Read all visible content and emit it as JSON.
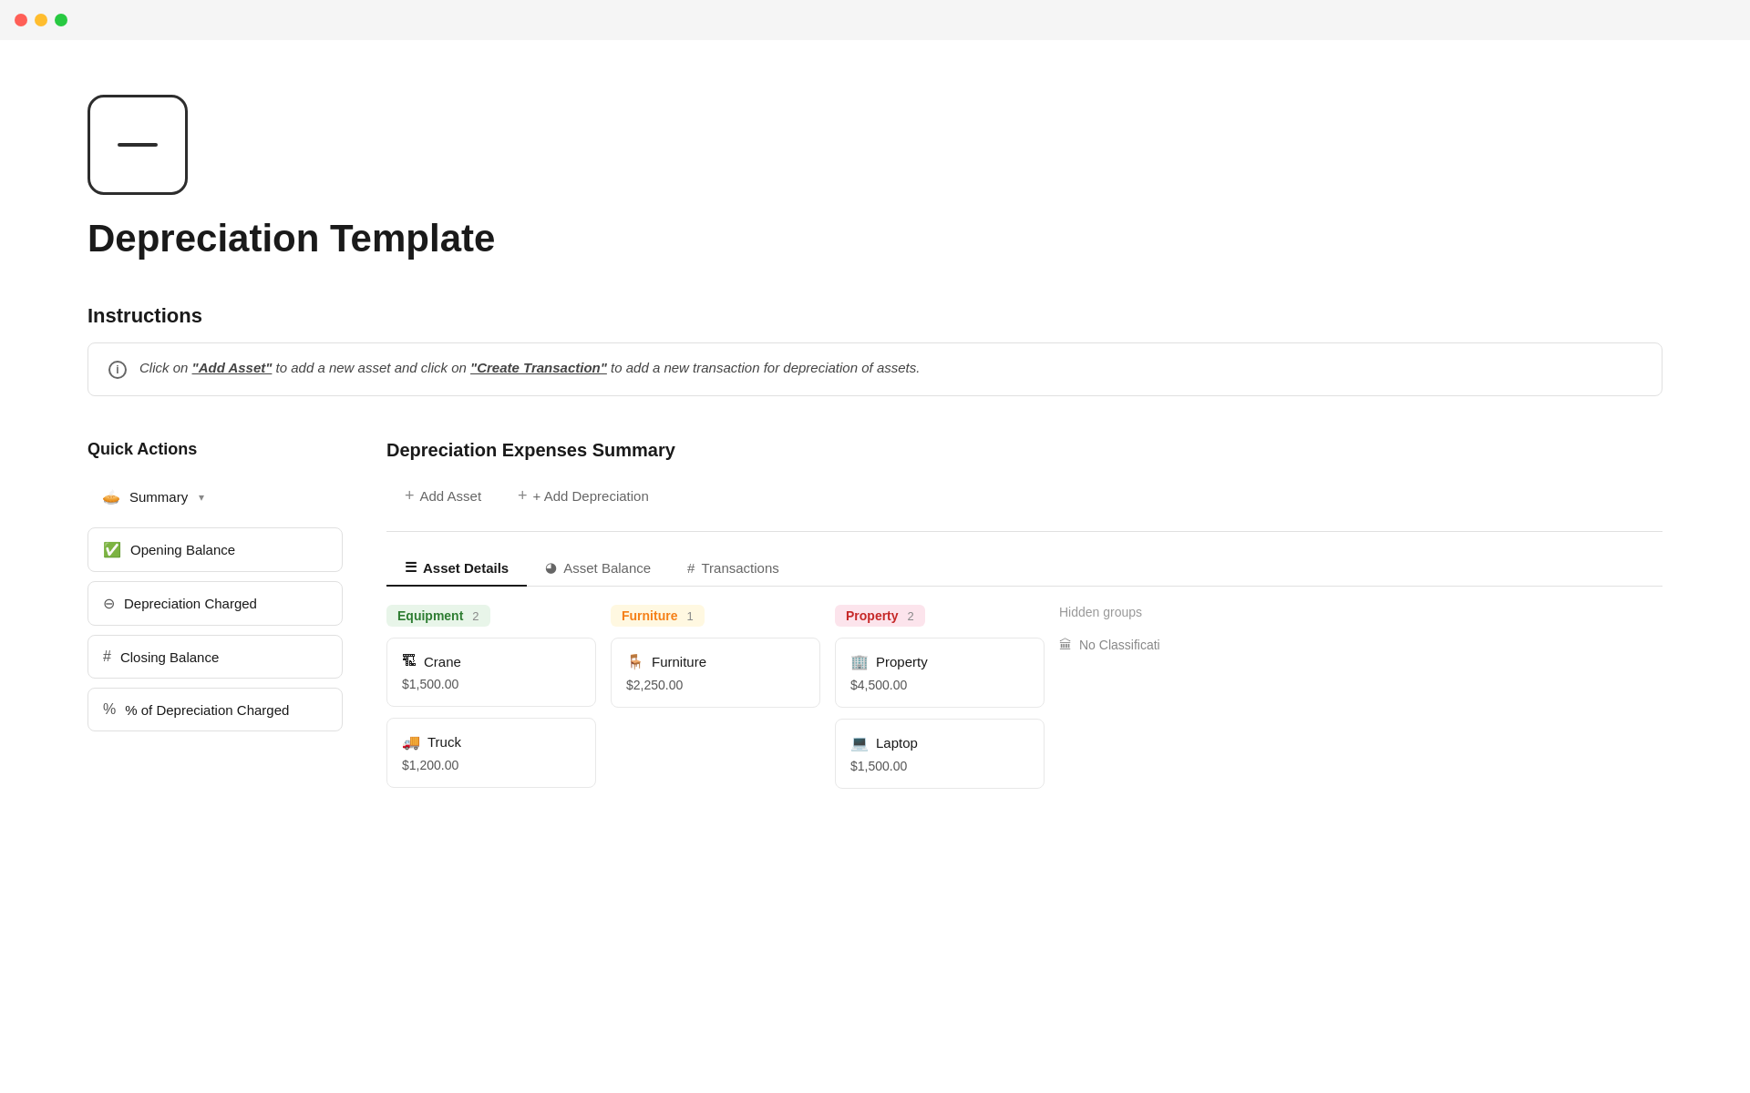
{
  "titlebar": {
    "traffic_lights": [
      "red",
      "yellow",
      "green"
    ]
  },
  "page": {
    "icon_label": "minus-icon",
    "title": "Depreciation Template",
    "instructions_section": "Instructions",
    "instructions_text_part1": "Click on ",
    "instructions_add_asset": "\"Add Asset\"",
    "instructions_text_part2": " to add a new asset and click on ",
    "instructions_create_transaction": "\"Create Transaction\"",
    "instructions_text_part3": " to add a new transaction for depreciation of assets."
  },
  "sidebar": {
    "section_title": "Quick Actions",
    "items": [
      {
        "id": "summary",
        "icon": "pie-chart",
        "label": "Summary",
        "has_chevron": true
      },
      {
        "id": "opening-balance",
        "icon": "check-circle",
        "label": "Opening Balance",
        "has_chevron": false
      },
      {
        "id": "depreciation-charged",
        "icon": "minus-circle",
        "label": "Depreciation Charged",
        "has_chevron": false
      },
      {
        "id": "closing-balance",
        "icon": "hash",
        "label": "Closing Balance",
        "has_chevron": false
      },
      {
        "id": "pct-depreciation",
        "icon": "percent",
        "label": "% of Depreciation Charged",
        "has_chevron": false
      }
    ]
  },
  "main": {
    "title": "Depreciation Expenses Summary",
    "add_asset_label": "+ Add Asset",
    "add_depreciation_label": "+ Add Depreciation",
    "tabs": [
      {
        "id": "asset-details",
        "icon": "table",
        "label": "Asset Details",
        "active": true
      },
      {
        "id": "asset-balance",
        "icon": "pie",
        "label": "Asset Balance",
        "active": false
      },
      {
        "id": "transactions",
        "icon": "hash",
        "label": "Transactions",
        "active": false
      }
    ],
    "groups": [
      {
        "id": "equipment",
        "label": "Equipment",
        "badge_class": "badge-equipment",
        "count": 2,
        "assets": [
          {
            "icon": "crane",
            "name": "Crane",
            "value": "$1,500.00"
          },
          {
            "icon": "truck",
            "name": "Truck",
            "value": "$1,200.00"
          }
        ]
      },
      {
        "id": "furniture",
        "label": "Furniture",
        "badge_class": "badge-furniture",
        "count": 1,
        "assets": [
          {
            "icon": "furniture",
            "name": "Furniture",
            "value": "$2,250.00"
          }
        ]
      },
      {
        "id": "property",
        "label": "Property",
        "badge_class": "badge-property",
        "count": 2,
        "assets": [
          {
            "icon": "property",
            "name": "Property",
            "value": "$4,500.00"
          },
          {
            "icon": "laptop",
            "name": "Laptop",
            "value": "$1,500.00"
          }
        ]
      }
    ],
    "hidden_groups": {
      "label": "Hidden groups",
      "items": [
        {
          "icon": "building",
          "label": "No Classificati"
        }
      ]
    }
  }
}
